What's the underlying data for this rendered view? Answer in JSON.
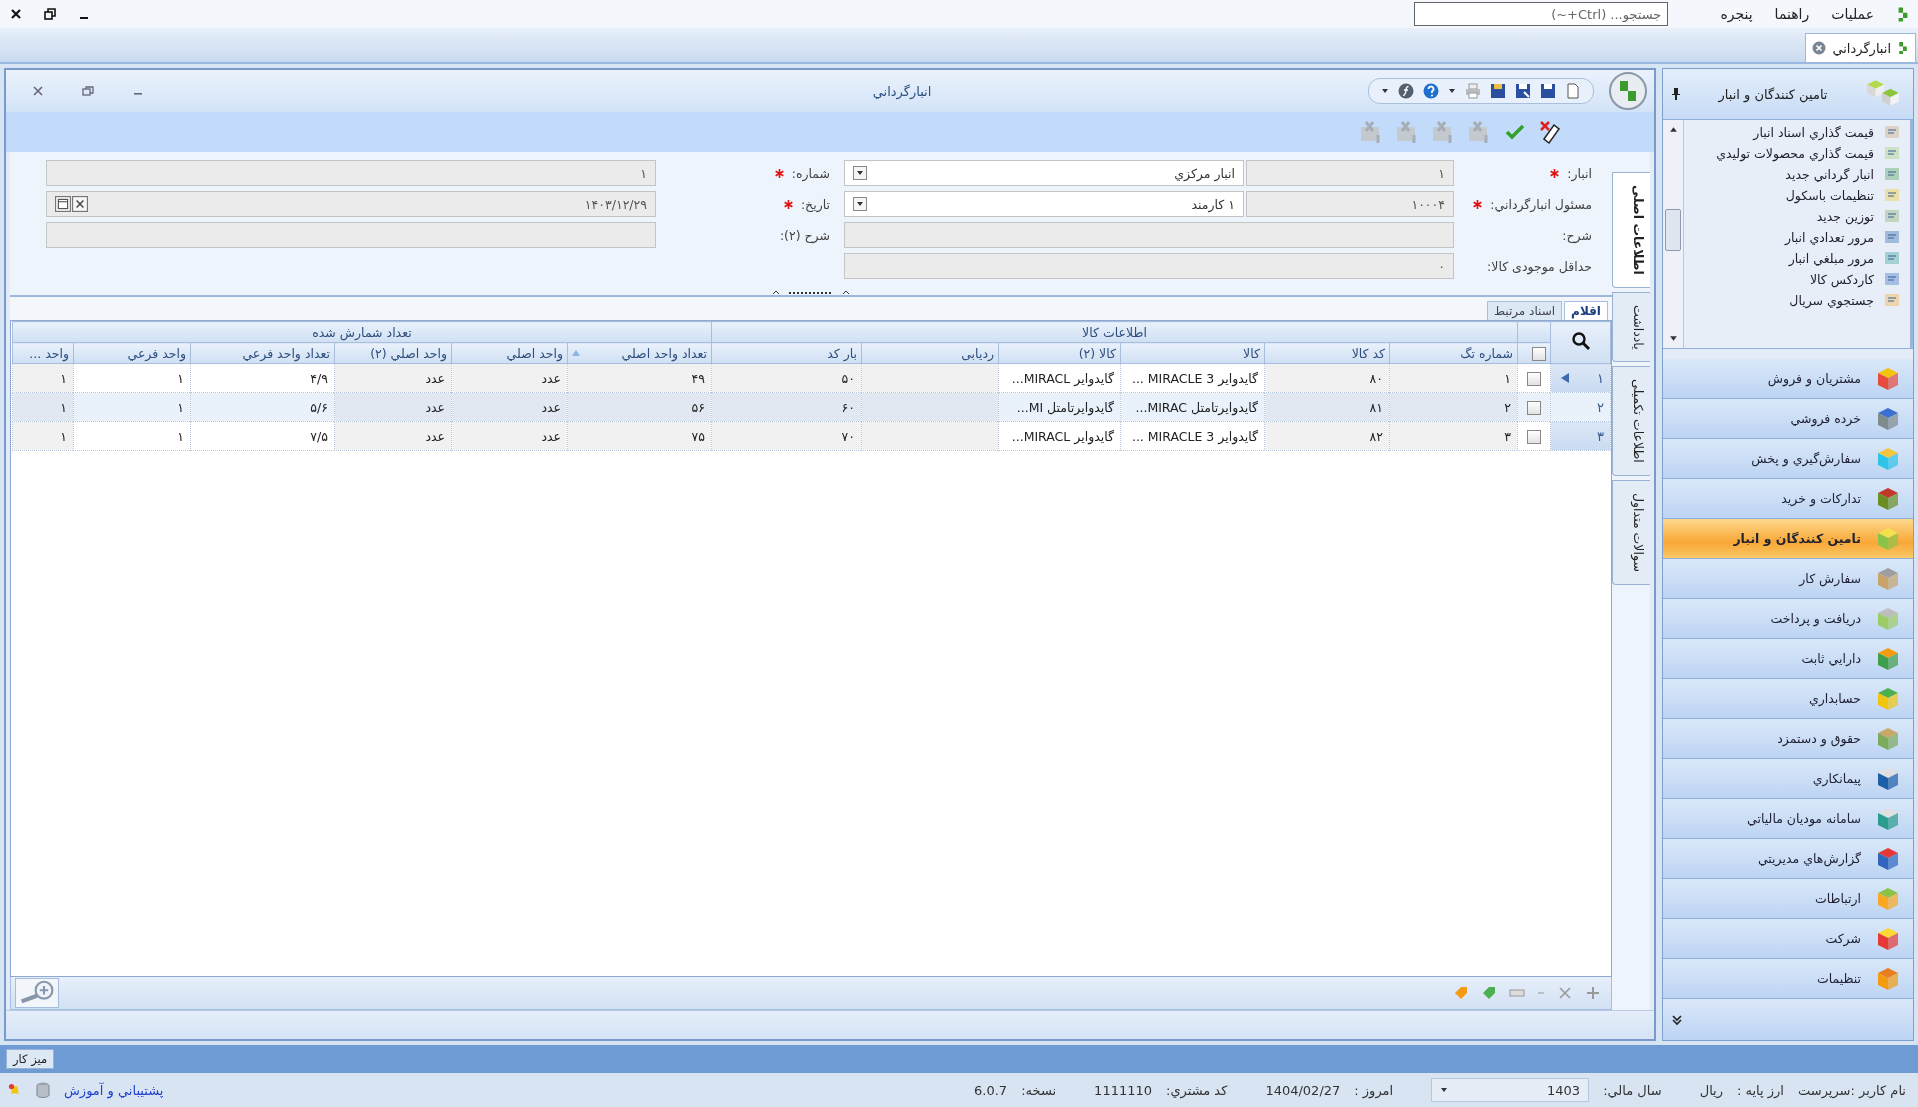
{
  "menu_bar": {
    "items": [
      {
        "label": "عملیات"
      },
      {
        "label": "راهنما"
      },
      {
        "label": "پنجره"
      }
    ],
    "search": {
      "placeholder": "جستجو... (Ctrl+~)"
    }
  },
  "document_tabs": [
    {
      "label": "انبارگرداني",
      "selected": true
    }
  ],
  "window": {
    "title": "انبارگرداني"
  },
  "form": {
    "right_fields": [
      {
        "label": "انبار:",
        "required": true,
        "kind": "lookup",
        "code": "۱",
        "value": "انبار مرکزي"
      },
      {
        "label": "مسئول انبارگرداني:",
        "required": true,
        "kind": "lookup",
        "code": "۱۰۰۰۴",
        "value": "۱ کارمند"
      },
      {
        "label": "شرح:",
        "required": false,
        "kind": "text"
      },
      {
        "label": "حداقل موجودی کالا:",
        "required": false,
        "kind": "text",
        "value": "۰"
      }
    ],
    "left_fields": [
      {
        "label": "شماره:",
        "required": true,
        "kind": "text",
        "value": "۱"
      },
      {
        "label": "تاریخ:",
        "required": true,
        "kind": "date",
        "value": "۱۴۰۳/۱۲/۲۹"
      },
      {
        "label": "شرح (۲):",
        "required": false,
        "kind": "text"
      }
    ]
  },
  "side_tabs": [
    {
      "label": "اطلاعات اصلی",
      "selected": true
    },
    {
      "label": "یادداشت",
      "selected": false
    },
    {
      "label": "اطلاعات تکمیلی",
      "selected": false
    },
    {
      "label": "سوالات متداول",
      "selected": false
    }
  ],
  "detail_tabs": [
    {
      "label": "اقلام",
      "selected": true
    },
    {
      "label": "اسناد مرتبط",
      "selected": false
    }
  ],
  "grid": {
    "select_all_checked": false,
    "column_groups": [
      {
        "label": "اطلاعات کالا",
        "columns": [
          {
            "label": "شماره تگ",
            "sorted": false
          },
          {
            "label": "کد کالا",
            "sorted": false
          },
          {
            "label": "کالا",
            "sorted": false
          },
          {
            "label": "کالا (۲)",
            "sorted": false
          },
          {
            "label": "ردیابی",
            "sorted": false
          },
          {
            "label": "بار کد",
            "sorted": false
          }
        ]
      },
      {
        "label": "تعداد شمارش شده",
        "columns": [
          {
            "label": "تعداد واحد اصلي",
            "sorted": true
          },
          {
            "label": "واحد اصلي",
            "sorted": false
          },
          {
            "label": "واحد اصلي (۲)",
            "sorted": false
          },
          {
            "label": "تعداد واحد فرعي",
            "sorted": false
          },
          {
            "label": "واحد فرعي",
            "sorted": false
          },
          {
            "label": "واحد ...",
            "sorted": false
          }
        ]
      }
    ],
    "rows": [
      {
        "number": "۱",
        "selected": true,
        "checked": false,
        "cells": [
          "۱",
          "۸۰",
          "گایدوایر MIRACLE 3 ...",
          "گایدوایر MIRACL...",
          null,
          "۵۰",
          "۴۹",
          "عدد",
          "عدد",
          "۴/۹",
          "۱",
          "۱"
        ]
      },
      {
        "number": "۲",
        "selected": false,
        "checked": false,
        "cells": [
          "۲",
          "۸۱",
          "گایدوایرتامتل MIRAC...",
          "گایدوایرتامتل MI...",
          null,
          "۶۰",
          "۵۶",
          "عدد",
          "عدد",
          "۵/۶",
          "۱",
          "۱"
        ]
      },
      {
        "number": "۳",
        "selected": false,
        "checked": false,
        "cells": [
          "۳",
          "۸۲",
          "گایدوایر MIRACLE 3 ...",
          "گایدوایر MIRACL...",
          null,
          "۷۰",
          "۷۵",
          "عدد",
          "عدد",
          "۷/۵",
          "۱",
          "۱"
        ]
      }
    ]
  },
  "sidebar": {
    "title": "تامین کنندگان و انبار",
    "links": [
      {
        "label": "قیمت گذاري اسناد انبار"
      },
      {
        "label": "قیمت گذاري محصولات توليدي"
      },
      {
        "label": "انبار گرداني جديد"
      },
      {
        "label": "تنظيمات باسکول"
      },
      {
        "label": "توزين جديد"
      },
      {
        "label": "مرور تعدادي انبار"
      },
      {
        "label": "مرور مبلغي انبار"
      },
      {
        "label": "کاردکس کالا"
      },
      {
        "label": "جستجوي سريال"
      }
    ],
    "modules": [
      {
        "label": "مشتريان و فروش",
        "selected": false
      },
      {
        "label": "خرده فروشي",
        "selected": false
      },
      {
        "label": "سفارش‌گيري و پخش",
        "selected": false
      },
      {
        "label": "تدارکات و خريد",
        "selected": false
      },
      {
        "label": "تامين کنندگان و انبار",
        "selected": true
      },
      {
        "label": "سفارش کار",
        "selected": false
      },
      {
        "label": "دريافت و پرداخت",
        "selected": false
      },
      {
        "label": "دارايي ثابت",
        "selected": false
      },
      {
        "label": "حسابداري",
        "selected": false
      },
      {
        "label": "حقوق و دستمزد",
        "selected": false
      },
      {
        "label": "پيمانکاري",
        "selected": false
      },
      {
        "label": "سامانه موديان مالياتي",
        "selected": false
      },
      {
        "label": "گزارش‌هاي مديريتي",
        "selected": false
      },
      {
        "label": "ارتباطات",
        "selected": false
      },
      {
        "label": "شرکت",
        "selected": false
      },
      {
        "label": "تنظيمات",
        "selected": false
      }
    ]
  },
  "taskbar": [
    {
      "label": "میز کار"
    }
  ],
  "status_bar": {
    "user": "نام کاربر :سرپرست",
    "base_currency_label": "ارز پایه :",
    "base_currency": "ریال",
    "fiscal_year_label": "سال مالي:",
    "fiscal_year": "1403",
    "today_label": "امروز :",
    "today": "1404/02/27",
    "customer_code_label": "کد مشتري:",
    "customer_code": "1111110",
    "version_label": "نسخه:",
    "version": "6.0.7",
    "support_link": "پشتيباني و آموزش"
  }
}
